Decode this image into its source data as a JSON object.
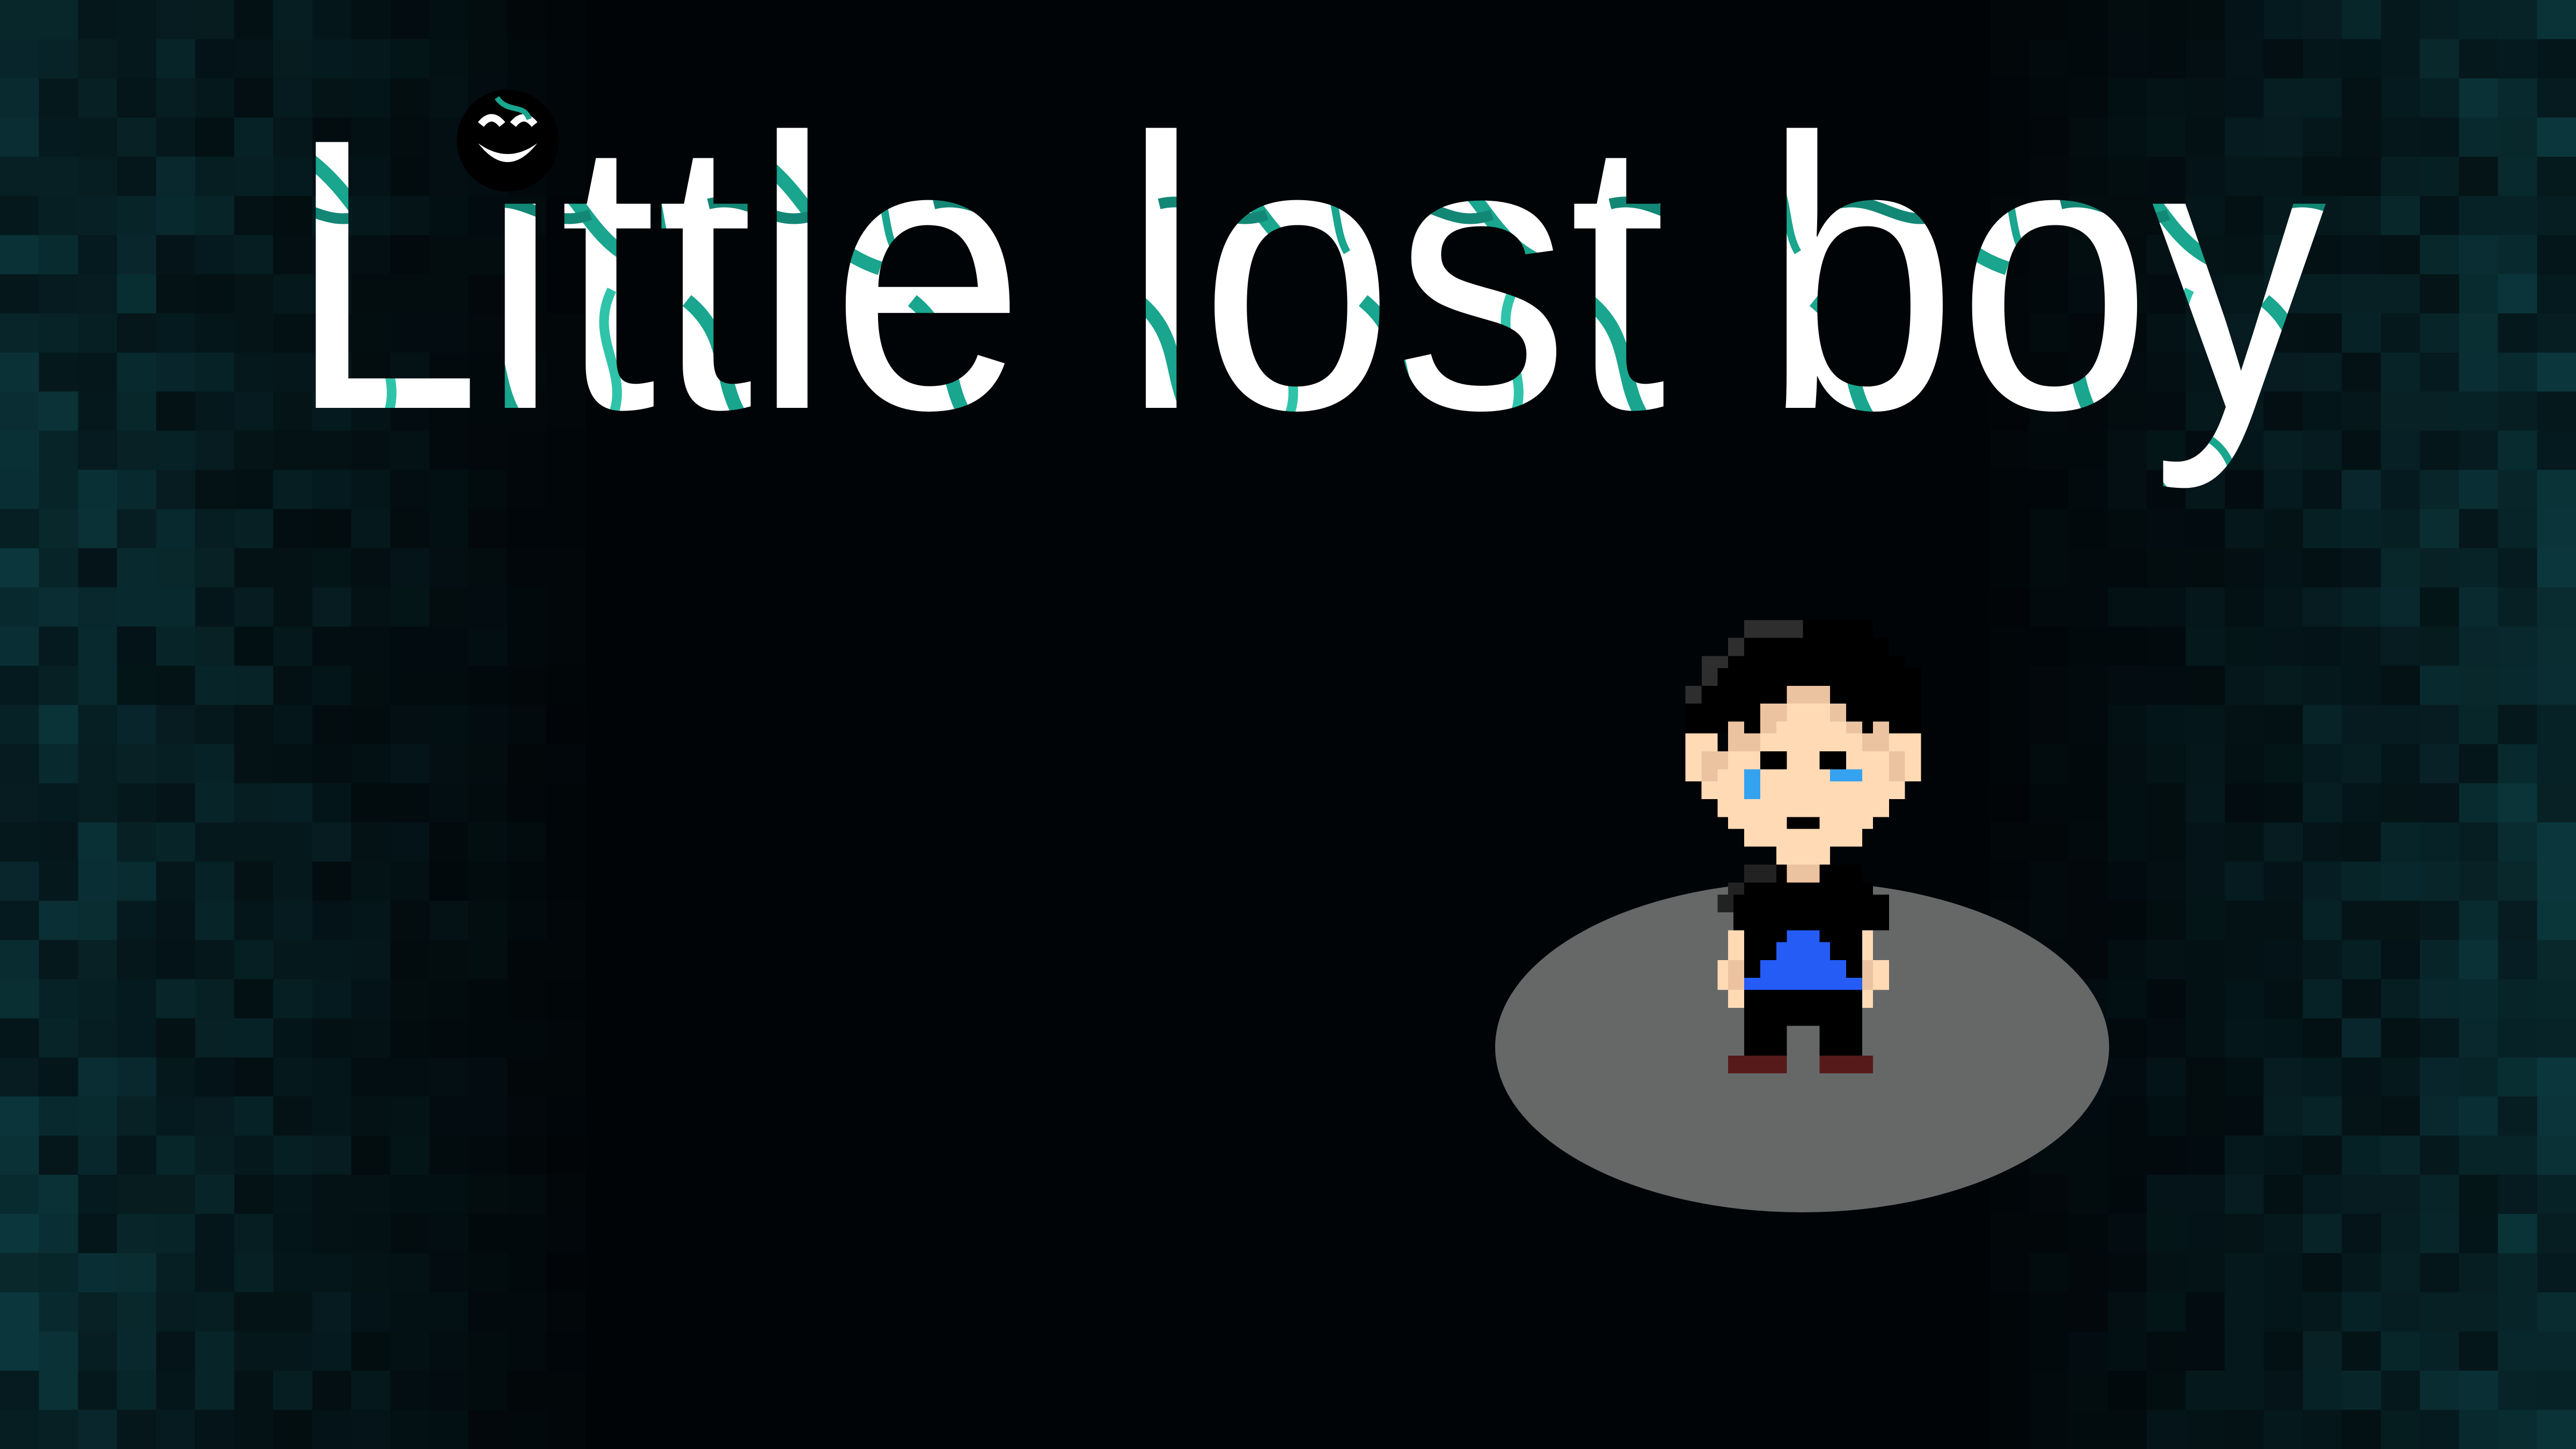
{
  "game": {
    "title": "Little lost boy"
  },
  "colors": {
    "background": "#010407",
    "mosaic_teal": "#0d3a3c",
    "title_fill": "#ffffff",
    "title_vein": "#19a58e",
    "spotlight": "#666868",
    "skin": "#ffdab5",
    "skin_shade": "#ecc3a0",
    "tear": "#35a2f0",
    "shirt": "#245cf5",
    "shoes": "#561a1b",
    "hair_highlight": "#2e2e2e"
  },
  "icons": {
    "emblem": "grinning-face-emblem-icon",
    "character": "crying-boy-sprite"
  }
}
